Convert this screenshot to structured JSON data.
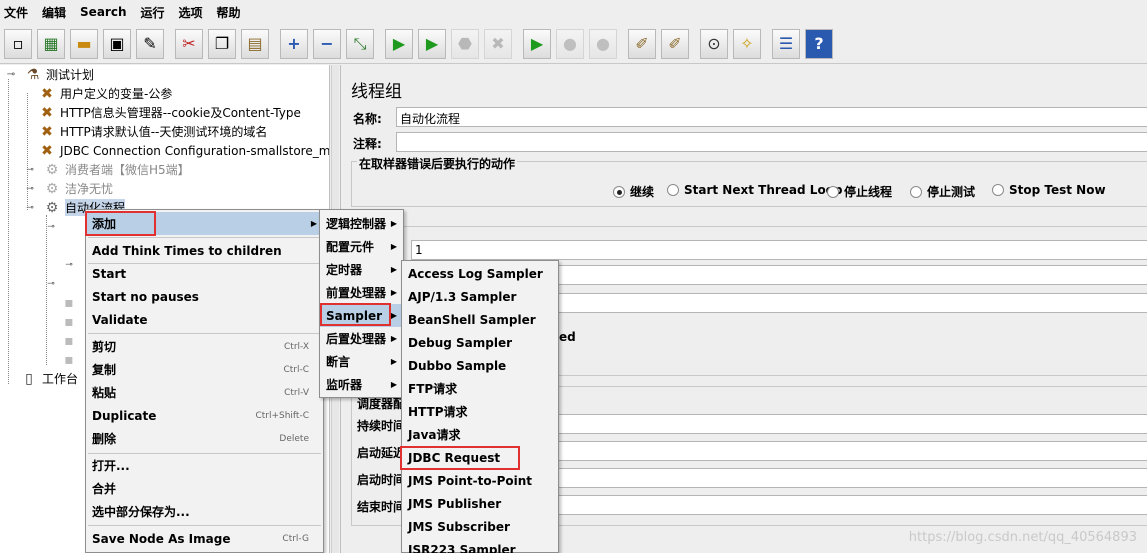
{
  "menubar": [
    "文件",
    "编辑",
    "Search",
    "运行",
    "选项",
    "帮助"
  ],
  "toolbar": [
    {
      "icon": "new-icon",
      "glyph": "▫"
    },
    {
      "icon": "templates-icon",
      "glyph": "▦"
    },
    {
      "icon": "open-icon",
      "glyph": "▬"
    },
    {
      "icon": "save-icon",
      "glyph": "▣"
    },
    {
      "icon": "save-as-icon",
      "glyph": "✎"
    },
    {
      "icon": "cut-icon",
      "glyph": "✂"
    },
    {
      "icon": "copy-icon",
      "glyph": "❐"
    },
    {
      "icon": "paste-icon",
      "glyph": "▤"
    },
    {
      "icon": "expand-icon",
      "glyph": "+"
    },
    {
      "icon": "collapse-icon",
      "glyph": "−"
    },
    {
      "icon": "toggle-icon",
      "glyph": "⤡"
    },
    {
      "icon": "start-icon",
      "glyph": "▶"
    },
    {
      "icon": "start-no-pauses-icon",
      "glyph": "▶"
    },
    {
      "icon": "stop-icon",
      "glyph": "⬣"
    },
    {
      "icon": "shutdown-icon",
      "glyph": "✖"
    },
    {
      "icon": "remote-start-icon",
      "glyph": "▶"
    },
    {
      "icon": "remote-stop-icon",
      "glyph": "●"
    },
    {
      "icon": "remote-shutdown-icon",
      "glyph": "●"
    },
    {
      "icon": "clear-icon",
      "glyph": "✐"
    },
    {
      "icon": "clear-all-icon",
      "glyph": "✐"
    },
    {
      "icon": "search-icon",
      "glyph": "⊙"
    },
    {
      "icon": "reset-search-icon",
      "glyph": "✧"
    },
    {
      "icon": "function-helper-icon",
      "glyph": "☰"
    },
    {
      "icon": "help-icon",
      "glyph": "?"
    }
  ],
  "tree": {
    "root": "测试计划",
    "items": [
      "用户定义的变量-公参",
      "HTTP信息头管理器--cookie及Content-Type",
      "HTTP请求默认值--天使测试环境的域名",
      "JDBC Connection Configuration-smallstore_mo",
      "消费者端【微信H5端】",
      "洁净无忧",
      "自动化流程"
    ],
    "workbench": "工作台"
  },
  "right": {
    "title": "线程组",
    "name_label": "名称:",
    "name_value": "自动化流程",
    "comment_label": "注释:",
    "error_group_label": "在取样器错误后要执行的动作",
    "radios": [
      "继续",
      "Start Next Thread Loop",
      "停止线程",
      "停止测试",
      "Stop Test Now"
    ],
    "selected_radio": "继续",
    "threads_value": "1",
    "ed_fragment": "ed",
    "scheduler_labels": [
      "调度器配",
      "持续时间",
      "启动延迟",
      "启动时间",
      "结束时间"
    ]
  },
  "context_menu": {
    "items": [
      {
        "label": "添加",
        "shortcut": "",
        "submenu": true
      },
      {
        "label": "Add Think Times to children",
        "shortcut": ""
      },
      {
        "label": "Start",
        "shortcut": ""
      },
      {
        "label": "Start no pauses",
        "shortcut": ""
      },
      {
        "label": "Validate",
        "shortcut": ""
      },
      {
        "label": "剪切",
        "shortcut": "Ctrl-X"
      },
      {
        "label": "复制",
        "shortcut": "Ctrl-C"
      },
      {
        "label": "粘贴",
        "shortcut": "Ctrl-V"
      },
      {
        "label": "Duplicate",
        "shortcut": "Ctrl+Shift-C"
      },
      {
        "label": "删除",
        "shortcut": "Delete"
      },
      {
        "label": "打开...",
        "shortcut": ""
      },
      {
        "label": "合并",
        "shortcut": ""
      },
      {
        "label": "选中部分保存为...",
        "shortcut": ""
      },
      {
        "label": "Save Node As Image",
        "shortcut": "Ctrl-G"
      }
    ]
  },
  "add_menu": {
    "items": [
      "逻辑控制器",
      "配置元件",
      "定时器",
      "前置处理器",
      "Sampler",
      "后置处理器",
      "断言",
      "监听器"
    ]
  },
  "sampler_menu": {
    "items": [
      "Access Log Sampler",
      "AJP/1.3 Sampler",
      "BeanShell Sampler",
      "Debug Sampler",
      "Dubbo Sample",
      "FTP请求",
      "HTTP请求",
      "Java请求",
      "JDBC Request",
      "JMS Point-to-Point",
      "JMS Publisher",
      "JMS Subscriber",
      "JSR223 Sampler"
    ]
  },
  "watermark": "https://blog.csdn.net/qq_40564893",
  "colors": {
    "highlight": "#b8cfe5",
    "red_box": "#e03030",
    "selection": "#c5d5ea"
  }
}
